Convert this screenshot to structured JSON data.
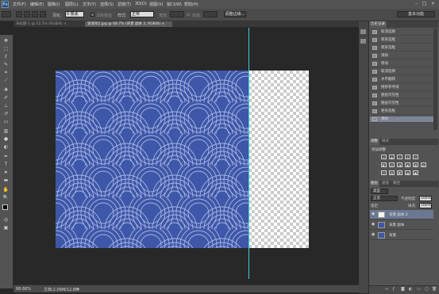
{
  "app": {
    "logo": "Ps"
  },
  "menubar": {
    "items": [
      "文件(F)",
      "编辑(E)",
      "图像(I)",
      "图层(L)",
      "文字(Y)",
      "选择(S)",
      "滤镜(T)",
      "3D(D)",
      "视图(V)",
      "窗口(W)",
      "帮助(H)"
    ],
    "window_controls": [
      "–",
      "□",
      "×"
    ]
  },
  "options_bar": {
    "feather_label": "羽化:",
    "feather_value": "0 像素",
    "antialias_label": "消除锯齿",
    "style_label": "样式:",
    "style_value": "正常",
    "width_label": "宽度:",
    "height_label": "高度:",
    "refine_button": "调整边缘...",
    "workspace": "基本功能"
  },
  "tabs": [
    {
      "label": "未标题-1 @ 52.5% (RGB/8) ×",
      "active": false
    },
    {
      "label": "波浪纹2.jpg @ 68.7% (背景 副本 2, RGB/8) ×",
      "active": true
    }
  ],
  "status": {
    "zoom": "68.66%",
    "doc": "文档:2.09M/12.8M"
  },
  "history": {
    "tabs": [
      "历史记录"
    ],
    "items": [
      {
        "label": "取消选择",
        "selected": false
      },
      {
        "label": "矩形选框",
        "selected": false
      },
      {
        "label": "矩形选框",
        "selected": false
      },
      {
        "label": "清除",
        "selected": false
      },
      {
        "label": "移动",
        "selected": false
      },
      {
        "label": "取消选择",
        "selected": false
      },
      {
        "label": "水平翻转",
        "selected": false
      },
      {
        "label": "拖移参考线",
        "selected": false
      },
      {
        "label": "图层可见性",
        "selected": false
      },
      {
        "label": "图层可见性",
        "selected": false
      },
      {
        "label": "矩形选框",
        "selected": false
      },
      {
        "label": "清除",
        "selected": true
      }
    ]
  },
  "adjustments": {
    "tabs": [
      "调整",
      "样式"
    ],
    "title": "添加调整"
  },
  "layers": {
    "tabs": [
      "图层",
      "通道",
      "路径"
    ],
    "kind_label": "类型",
    "blend_mode": "正常",
    "opacity_label": "不透明度:",
    "opacity_value": "100%",
    "lock_label": "锁定:",
    "fill_label": "填充:",
    "fill_value": "100%",
    "items": [
      {
        "name": "背景 副本 2",
        "selected": true,
        "thumb": "white"
      },
      {
        "name": "背景 副本",
        "selected": false,
        "thumb": "blue"
      },
      {
        "name": "背景",
        "selected": false,
        "thumb": "blue"
      }
    ]
  },
  "colors": {
    "pattern": "#3e57a8",
    "guide": "#3bd0d7",
    "selected": "#7d8596"
  }
}
